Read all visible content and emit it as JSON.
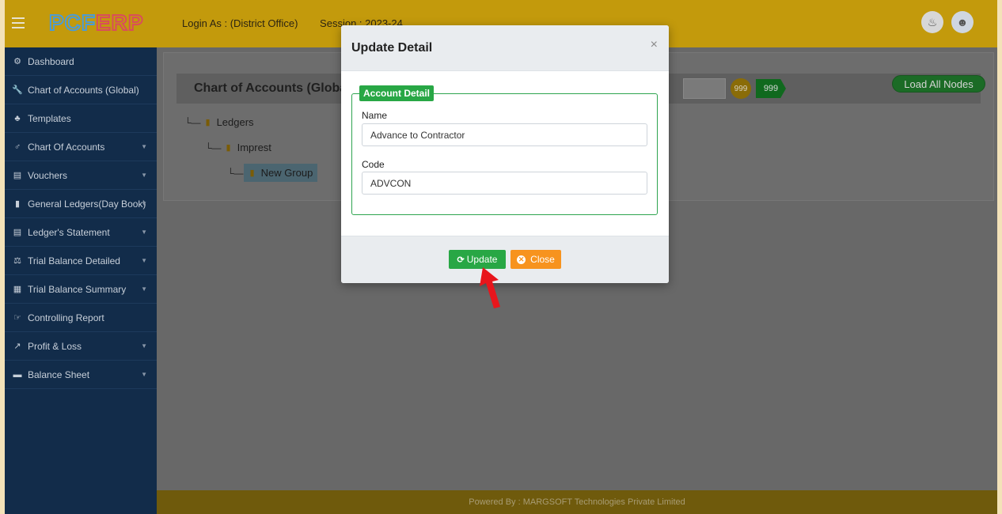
{
  "app": {
    "logo_text": "PCFERP",
    "login_as": "Login As :  (District Office)",
    "session": "Session : 2023-24"
  },
  "sidebar": {
    "items": [
      {
        "label": "Dashboard",
        "icon": "dashboard-icon",
        "glyph": "⚙",
        "has_caret": false
      },
      {
        "label": "Chart of Accounts (Global)",
        "icon": "wrench-icon",
        "glyph": "🔧",
        "has_caret": false
      },
      {
        "label": "Templates",
        "icon": "sitemap-icon",
        "glyph": "♣",
        "has_caret": false
      },
      {
        "label": "Chart Of Accounts",
        "icon": "gender-icon",
        "glyph": "♂",
        "has_caret": true
      },
      {
        "label": "Vouchers",
        "icon": "id-card-icon",
        "glyph": "▤",
        "has_caret": true
      },
      {
        "label": "General Ledgers(Day Book)",
        "icon": "book-icon",
        "glyph": "▮",
        "has_caret": true
      },
      {
        "label": "Ledger's Statement",
        "icon": "file-icon",
        "glyph": "▤",
        "has_caret": true
      },
      {
        "label": "Trial Balance Detailed",
        "icon": "balance-scale-icon",
        "glyph": "⚖",
        "has_caret": true
      },
      {
        "label": "Trial Balance Summary",
        "icon": "calculator-icon",
        "glyph": "▦",
        "has_caret": true
      },
      {
        "label": "Controlling Report",
        "icon": "hand-pointer-icon",
        "glyph": "☞",
        "has_caret": false
      },
      {
        "label": "Profit & Loss",
        "icon": "line-chart-icon",
        "glyph": "↗",
        "has_caret": true
      },
      {
        "label": "Balance Sheet",
        "icon": "briefcase-icon",
        "glyph": "▬",
        "has_caret": true
      }
    ]
  },
  "main": {
    "card_title": "Chart of Accounts (Global)",
    "badge_count_1": "999",
    "badge_count_2": "999",
    "load_all_label": "Load All Nodes",
    "tree": [
      {
        "label": "Ledgers",
        "level": 0
      },
      {
        "label": "Imprest",
        "level": 1
      },
      {
        "label": "New Group",
        "level": 2,
        "selected": true
      }
    ]
  },
  "footer": {
    "text": "Powered By : MARGSOFT Technologies Private Limited"
  },
  "modal": {
    "title": "Update Detail",
    "close_glyph": "×",
    "section_legend": "Account Detail",
    "name_label": "Name",
    "name_value": "Advance to Contractor",
    "code_label": "Code",
    "code_value": "ADVCON",
    "update_label": "Update",
    "close_label": "Close"
  },
  "colors": {
    "topbar": "#c39a0c",
    "sidebar": "#122c4a",
    "accent_green": "#28a745",
    "accent_orange": "#f7931e",
    "annotation_arrow": "#e8161c"
  }
}
